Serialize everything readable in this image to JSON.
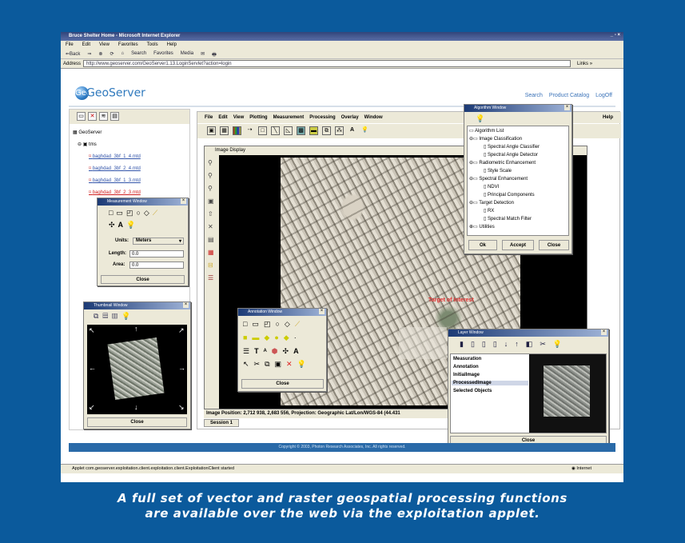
{
  "browser": {
    "title": "Bruce Shelter Home - Microsoft Internet Explorer",
    "window_controls": "_ ▫ ×",
    "menu": [
      "File",
      "Edit",
      "View",
      "Favorites",
      "Tools",
      "Help"
    ],
    "toolbar": [
      "⇐Back",
      "⇒",
      "⊗",
      "⟳",
      "⌂",
      "Search",
      "Favorites",
      "Media",
      "✉",
      "🖶"
    ],
    "address_label": "Address",
    "address_url": "http://www.geoserver.com/GeoServer1.13.LoginServlet?action=login",
    "links_label": "Links »",
    "status_text": "Applet com.geoserver.exploitation.client.exploitation.client.ExploitationClient started",
    "zone": "Internet"
  },
  "site": {
    "logo_text": "GeoServer",
    "logo_glyph": "Geo",
    "links": [
      "Search",
      "Product Catalog",
      "LogOff"
    ],
    "footer": "Copyright © 2003, Photon Research Associates, Inc. All rights reserved."
  },
  "tree": {
    "root": "GeoServer",
    "folder": "tms",
    "items": [
      "baghdad_3bf_1_4.mtd",
      "baghdad_3bf_2_4.mtd",
      "baghdad_3bf_1_3.mtd",
      "baghdad_3bf_2_3.mtd"
    ]
  },
  "measurement": {
    "title": "Measurement Window",
    "units_label": "Units:",
    "units_value": "Meters",
    "length_label": "Length:",
    "length_value": "0.0",
    "area_label": "Area:",
    "area_value": "0.0",
    "close": "Close"
  },
  "thumbnail": {
    "title": "Thumbnail Window",
    "close": "Close"
  },
  "applet": {
    "menu": [
      "File",
      "Edit",
      "View",
      "Plotting",
      "Measurement",
      "Processing",
      "Overlay",
      "Window"
    ],
    "help": "Help",
    "image_title": "Image Display",
    "target_label": "Target of Interest",
    "position": "Image Position: 2,712 938, 2,683 556, Projection: Geographic Lat/Lon/WGS-84 (44.431",
    "session_tab": "Session 1"
  },
  "annotation": {
    "title": "Annotation Window",
    "close": "Close"
  },
  "algorithm": {
    "title": "Algorithm Window",
    "rows": [
      {
        "text": "Algorithm List",
        "level": 0
      },
      {
        "text": "Image Classification",
        "level": 1
      },
      {
        "text": "Spectral Angle Classifier",
        "level": 2
      },
      {
        "text": "Spectral Angle Detector",
        "level": 2
      },
      {
        "text": "Radiometric Enhancement",
        "level": 1
      },
      {
        "text": "Style Scale",
        "level": 2
      },
      {
        "text": "Spectral Enhancement",
        "level": 1
      },
      {
        "text": "NDVI",
        "level": 2
      },
      {
        "text": "Principal Components",
        "level": 2
      },
      {
        "text": "Target Detection",
        "level": 1
      },
      {
        "text": "RX",
        "level": 2
      },
      {
        "text": "Spectral Match Filter",
        "level": 2
      },
      {
        "text": "Utilities",
        "level": 1
      }
    ],
    "buttons": [
      "Ok",
      "Accept",
      "Close"
    ]
  },
  "layer": {
    "title": "Layer Window",
    "items": [
      "Measuration",
      "Annotation",
      "InitialImage",
      "ProcessedImage",
      "Selected Objects"
    ],
    "selected_index": 3,
    "close": "Close"
  },
  "caption": {
    "line1": "A full set of vector and raster geospatial processing functions",
    "line2": "are available over the web via the exploitation applet."
  },
  "colors": {
    "background": "#0b5a9c",
    "titlebar": "#1c3a75",
    "chrome": "#ece9d8",
    "target_label": "#e03030"
  }
}
